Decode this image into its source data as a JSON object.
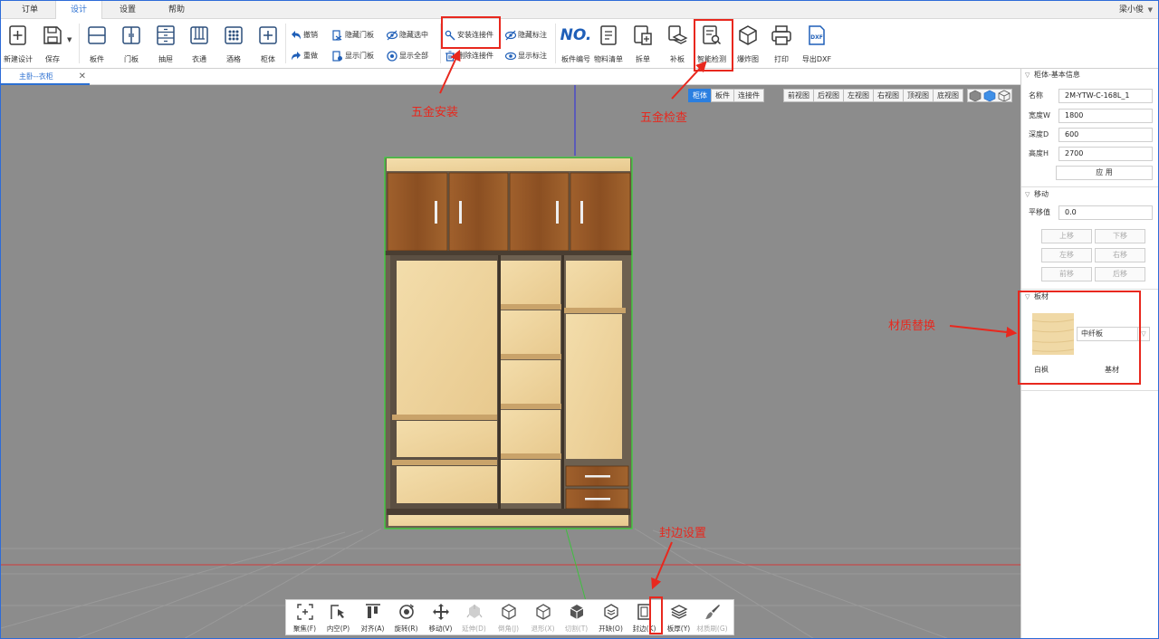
{
  "menu": {
    "tabs": [
      {
        "label": "订单"
      },
      {
        "label": "设计"
      },
      {
        "label": "设置"
      },
      {
        "label": "帮助"
      }
    ],
    "active_tab": "设计",
    "user": "梁小俊"
  },
  "ribbon": {
    "new_design": "新建设计",
    "save": "保存",
    "board": "板件",
    "door": "门板",
    "drawer": "抽屉",
    "wardrobe": "衣通",
    "wine_rack": "酒格",
    "cabinet": "柜体",
    "undo": "撤销",
    "redo": "重做",
    "hide_door": "隐藏门板",
    "show_door": "显示门板",
    "hide_selected": "隐藏选中",
    "show_all": "显示全部",
    "install_connector": "安装连接件",
    "delete_connector": "删除连接件",
    "hide_label": "隐藏标注",
    "show_label": "显示标注",
    "board_number_icon": "NO.",
    "board_number": "板件编号",
    "material_list": "物料清单",
    "split_list": "拆单",
    "patch_board": "补板",
    "smart_check": "智能检测",
    "exploded_view": "爆炸图",
    "print": "打印",
    "export_dxf_icon": "DXF",
    "export_dxf": "导出DXF"
  },
  "doc_tab": {
    "label": "主卧--衣柜"
  },
  "viewbar": {
    "filters": [
      "柜体",
      "板件",
      "连接件"
    ],
    "active_filter": "柜体",
    "views": [
      "前视图",
      "后视图",
      "左视图",
      "右视图",
      "顶视图",
      "底视图"
    ]
  },
  "bottom_toolbar": [
    {
      "label": "聚焦(F)",
      "disabled": false
    },
    {
      "label": "内空(P)",
      "disabled": false
    },
    {
      "label": "对齐(A)",
      "disabled": false
    },
    {
      "label": "旋转(R)",
      "disabled": false
    },
    {
      "label": "移动(V)",
      "disabled": false
    },
    {
      "label": "延伸(D)",
      "disabled": true
    },
    {
      "label": "倒角(J)",
      "disabled": true
    },
    {
      "label": "退形(X)",
      "disabled": true
    },
    {
      "label": "切割(T)",
      "disabled": true
    },
    {
      "label": "开缺(O)",
      "disabled": false
    },
    {
      "label": "封边(K)",
      "disabled": false
    },
    {
      "label": "板厚(Y)",
      "disabled": false
    },
    {
      "label": "材质刷(G)",
      "disabled": true
    }
  ],
  "right_panel": {
    "basic_info_title": "柜体-基本信息",
    "name_label": "名称",
    "name_value": "2M-YTW-C-168L_1",
    "width_label": "宽度W",
    "width_value": "1800",
    "depth_label": "深度D",
    "depth_value": "600",
    "height_label": "高度H",
    "height_value": "2700",
    "apply": "应 用",
    "move_title": "移动",
    "offset_label": "平移值",
    "offset_value": "0.0",
    "move_up": "上移",
    "move_down": "下移",
    "move_left": "左移",
    "move_right": "右移",
    "move_front": "前移",
    "move_back": "后移",
    "board_title": "板材",
    "material_select": "中纤板",
    "material_name": "白枫",
    "substrate": "基材"
  },
  "annotations": {
    "hardware_install": "五金安装",
    "hardware_check": "五金检查",
    "material_replace": "材质替换",
    "edge_setting": "封边设置"
  },
  "colors": {
    "accent": "#2b6fd1",
    "annotation_red": "#e8281e",
    "viewport_bg": "#8c8c8c",
    "wood_dark": "#9a5a28",
    "wood_light": "#f0d9a6"
  }
}
